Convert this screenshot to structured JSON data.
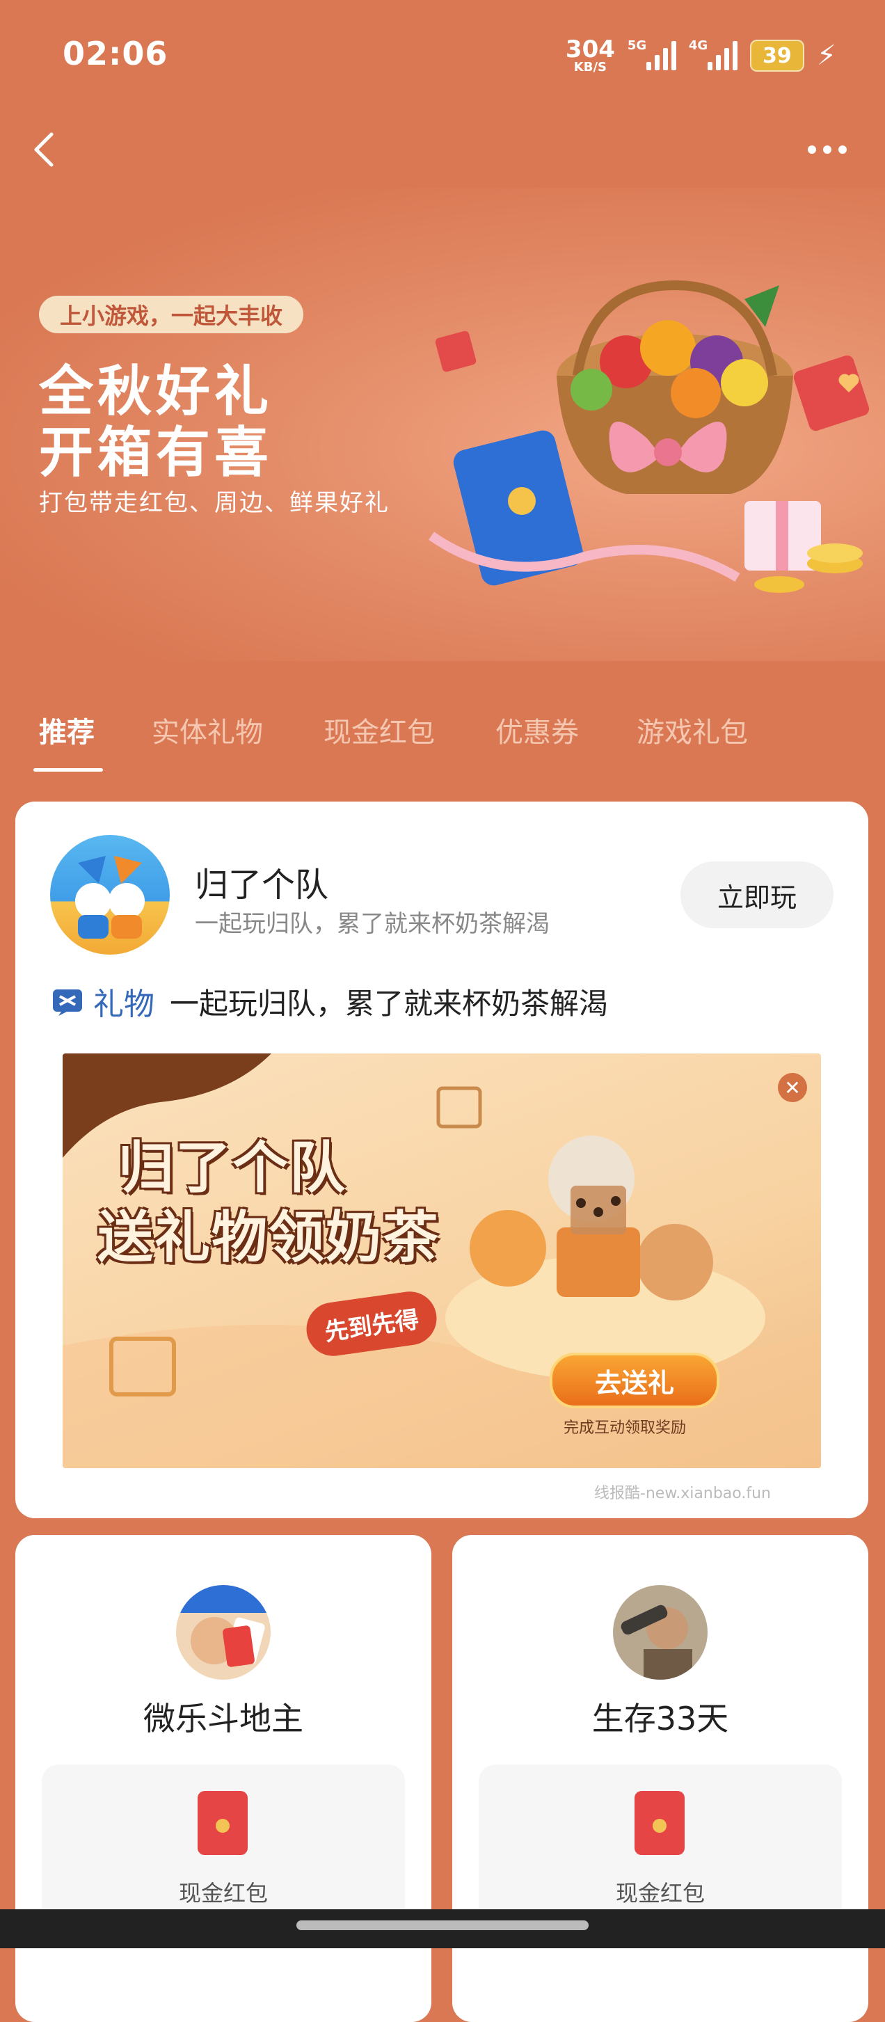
{
  "status": {
    "time": "02:06",
    "speed": "304",
    "speed_unit": "KB/S",
    "sig1_tag": "5G",
    "sig2_tag": "4G",
    "battery": "39"
  },
  "banner": {
    "pill": "上小游戏，一起大丰收",
    "title_line1": "全秋好礼",
    "title_line2": "开箱有喜",
    "subtitle": "打包带走红包、周边、鲜果好礼"
  },
  "tabs": [
    {
      "label": "推荐",
      "active": true
    },
    {
      "label": "实体礼物"
    },
    {
      "label": "现金红包"
    },
    {
      "label": "优惠券"
    },
    {
      "label": "游戏礼包"
    }
  ],
  "featured": {
    "name": "归了个队",
    "desc": "一起玩归队，累了就来杯奶茶解渴",
    "play_label": "立即玩",
    "gift_tag": "礼物",
    "gift_text": "一起玩归队，累了就来杯奶茶解渴",
    "promo": {
      "title1": "归了个队",
      "title2": "送礼物领奶茶",
      "stamp": "先到先得",
      "button": "去送礼",
      "note": "完成互动领取奖励"
    },
    "watermark": "线报酷-new.xianbao.fun"
  },
  "games": [
    {
      "name": "微乐斗地主",
      "reward": "现金红包"
    },
    {
      "name": "生存33天",
      "reward": "现金红包"
    }
  ],
  "colors": {
    "background": "#D97853",
    "accent_blue": "#3468B8",
    "red_packet": "#E64545"
  }
}
